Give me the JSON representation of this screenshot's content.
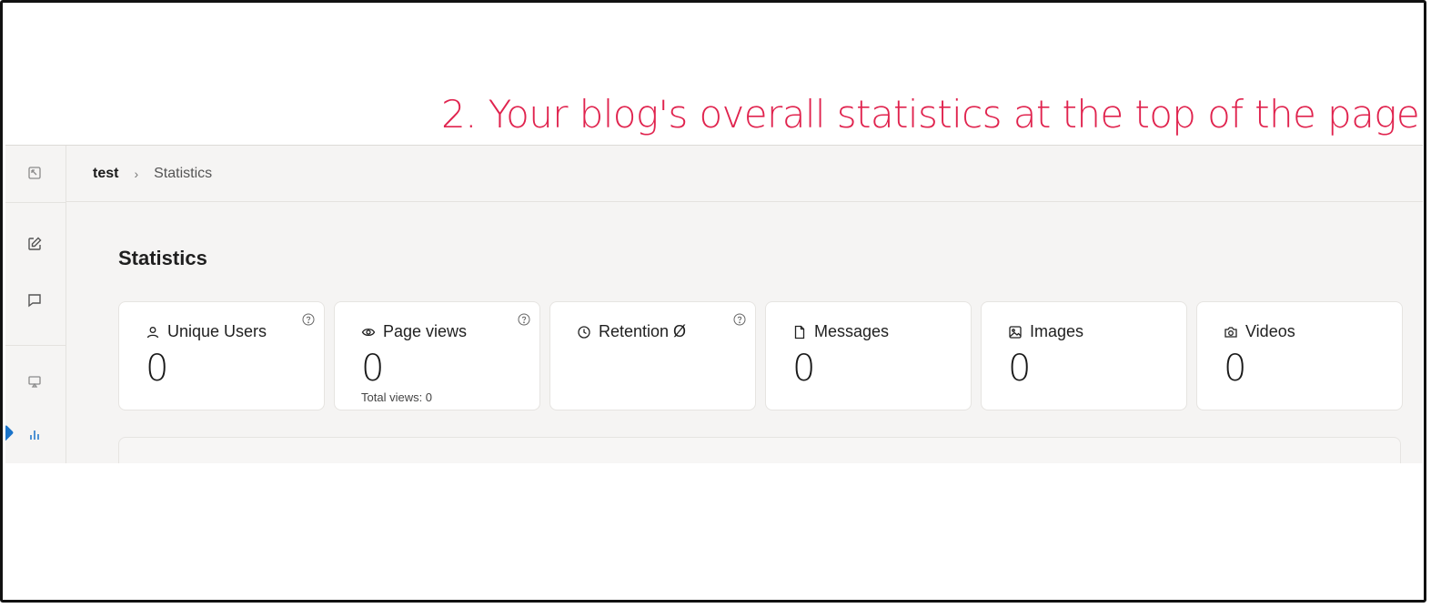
{
  "caption": "2. Your blog's overall statistics at the top of the page",
  "colors": {
    "caption": "#e0234e",
    "accent": "#1a73c9"
  },
  "sidebar": {
    "icons": [
      "collapse-icon",
      "edit-icon",
      "comment-icon",
      "display-icon",
      "bar-chart-icon"
    ]
  },
  "breadcrumb": {
    "root": "test",
    "separator": "›",
    "current": "Statistics"
  },
  "page_title": "Statistics",
  "cards": [
    {
      "label": "Unique Users",
      "icon": "user-icon",
      "value": "0",
      "help": true
    },
    {
      "label": "Page views",
      "icon": "eye-icon",
      "value": "0",
      "sub": "Total views: 0",
      "help": true
    },
    {
      "label": "Retention Ø",
      "icon": "clock-icon",
      "value": "",
      "help": true
    },
    {
      "label": "Messages",
      "icon": "file-icon",
      "value": "0"
    },
    {
      "label": "Images",
      "icon": "image-icon",
      "value": "0"
    },
    {
      "label": "Videos",
      "icon": "camera-icon",
      "value": "0"
    }
  ]
}
